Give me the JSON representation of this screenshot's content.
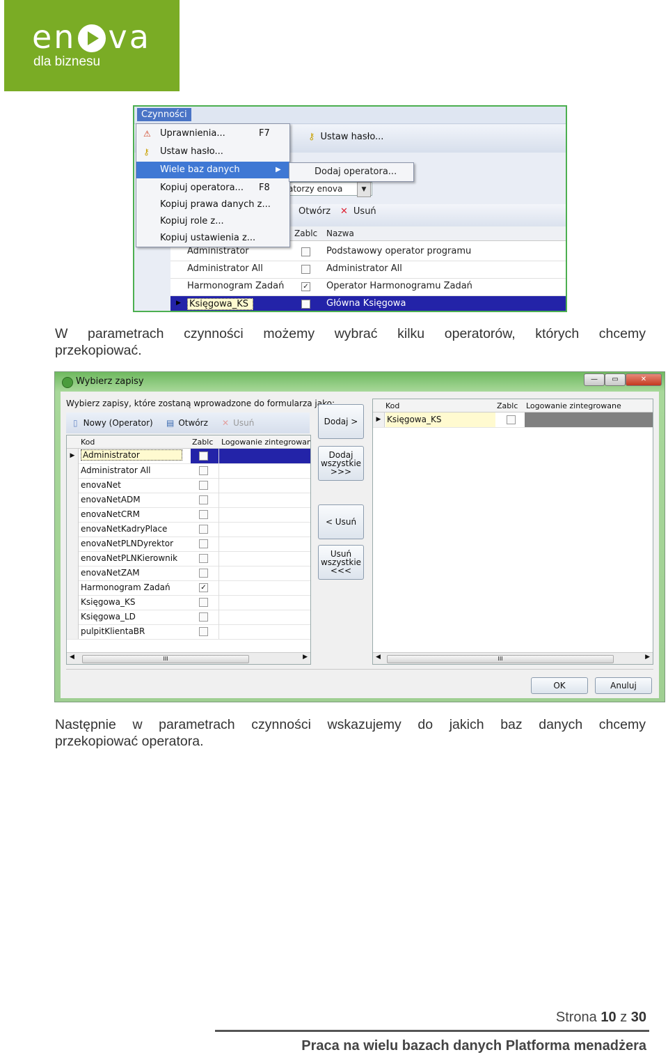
{
  "logo": {
    "wordmark": "en va",
    "tagline": "dla biznesu"
  },
  "shot1": {
    "menu_tab": "Czynności",
    "toolbar_set_password": "Ustaw hasło...",
    "combo_value": "atorzy enova",
    "toolbar2": {
      "open": "Otwórz",
      "delete": "Usuń"
    },
    "grid_headers": {
      "blocked": "Zablc",
      "name": "Nazwa"
    },
    "menu_items": [
      {
        "label": "Uprawnienia...",
        "shortcut": "F7",
        "icon": "warning-icon"
      },
      {
        "label": "Ustaw hasło...",
        "shortcut": "",
        "icon": "key-icon"
      },
      {
        "label": "Wiele baz danych",
        "shortcut": "",
        "icon": "",
        "submenu": true
      },
      {
        "label": "Kopiuj operatora...",
        "shortcut": "F8",
        "icon": ""
      },
      {
        "label": "Kopiuj prawa danych z...",
        "shortcut": "",
        "icon": ""
      },
      {
        "label": "Kopiuj role z...",
        "shortcut": "",
        "icon": ""
      },
      {
        "label": "Kopiuj ustawienia z...",
        "shortcut": "",
        "icon": ""
      }
    ],
    "submenu_item": "Dodaj operatora...",
    "rows": [
      {
        "code": "Administrator",
        "blocked": false,
        "name": "Podstawowy operator programu"
      },
      {
        "code": "Administrator All",
        "blocked": false,
        "name": "Administrator All"
      },
      {
        "code": "Harmonogram Zadań",
        "blocked": true,
        "name": "Operator Harmonogramu Zadań"
      },
      {
        "code": "Księgowa_KS",
        "blocked": false,
        "name": "Główna Księgowa",
        "selected": true
      }
    ]
  },
  "para1": {
    "line1": "W parametrach czynności możemy wybrać kilku operatorów, których chcemy",
    "line2": "przekopiować."
  },
  "shot2": {
    "title": "Wybierz zapisy",
    "prompt": "Wybierz zapisy, które zostaną wprowadzone do formularza jako:",
    "toolbar": {
      "new": "Nowy (Operator)",
      "open": "Otwórz",
      "delete": "Usuń"
    },
    "left_headers": {
      "code": "Kod",
      "blocked": "Zablc",
      "login": "Logowanie zintegrowane"
    },
    "left_rows": [
      {
        "code": "Administrator",
        "blocked": false,
        "selected": true
      },
      {
        "code": "Administrator All",
        "blocked": false
      },
      {
        "code": "enovaNet",
        "blocked": false
      },
      {
        "code": "enovaNetADM",
        "blocked": false
      },
      {
        "code": "enovaNetCRM",
        "blocked": false
      },
      {
        "code": "enovaNetKadryPlace",
        "blocked": false
      },
      {
        "code": "enovaNetPLNDyrektor",
        "blocked": false
      },
      {
        "code": "enovaNetPLNKierownik",
        "blocked": false
      },
      {
        "code": "enovaNetZAM",
        "blocked": false
      },
      {
        "code": "Harmonogram Zadań",
        "blocked": true
      },
      {
        "code": "Księgowa_KS",
        "blocked": false
      },
      {
        "code": "Księgowa_LD",
        "blocked": false
      },
      {
        "code": "pulpitKlientaBR",
        "blocked": false
      }
    ],
    "buttons": {
      "add": "Dodaj >",
      "add_all": "Dodaj\nwszystkie\n>>>",
      "remove": "< Usuń",
      "remove_all": "Usuń\nwszystkie\n<<<"
    },
    "right_headers": {
      "code": "Kod",
      "blocked": "Zablc",
      "login": "Logowanie zintegrowane"
    },
    "right_rows": [
      {
        "code": "Księgowa_KS",
        "blocked": false
      }
    ],
    "scroll_grip": "III",
    "ok": "OK",
    "cancel": "Anuluj"
  },
  "para2": {
    "line1": "Następnie w parametrach czynności wskazujemy do jakich baz danych chcemy",
    "line2": "przekopiować operatora."
  },
  "footer": {
    "page_prefix": "Strona",
    "page_current": "10",
    "page_sep": "z",
    "page_total": "30",
    "title": "Praca na wielu bazach danych Platforma menadżera"
  },
  "colors": {
    "brand_green": "#7aac25",
    "selection_blue": "#2323a8"
  }
}
